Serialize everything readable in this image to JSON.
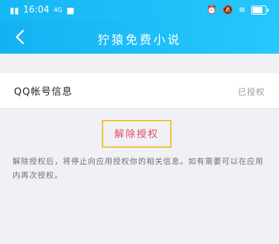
{
  "status_bar": {
    "time": "16:04",
    "network_label": "4G",
    "icons": [
      "signal-icon",
      "camera-icon",
      "alarm-icon",
      "mute-icon",
      "wifi-icon",
      "battery-icon"
    ],
    "colors": {
      "background": "#1ab9f7"
    }
  },
  "nav": {
    "title": "狞猿免费小说",
    "back_icon": "chevron-left-icon"
  },
  "account_row": {
    "label": "QQ帐号信息",
    "status": "已授权"
  },
  "revoke": {
    "label": "解除授权",
    "accent": "#e34b62",
    "highlight_border": "#f2c037"
  },
  "description": "解除授权后，将停止向应用授权你的相关信息。如有需要可以在应用内再次授权。"
}
